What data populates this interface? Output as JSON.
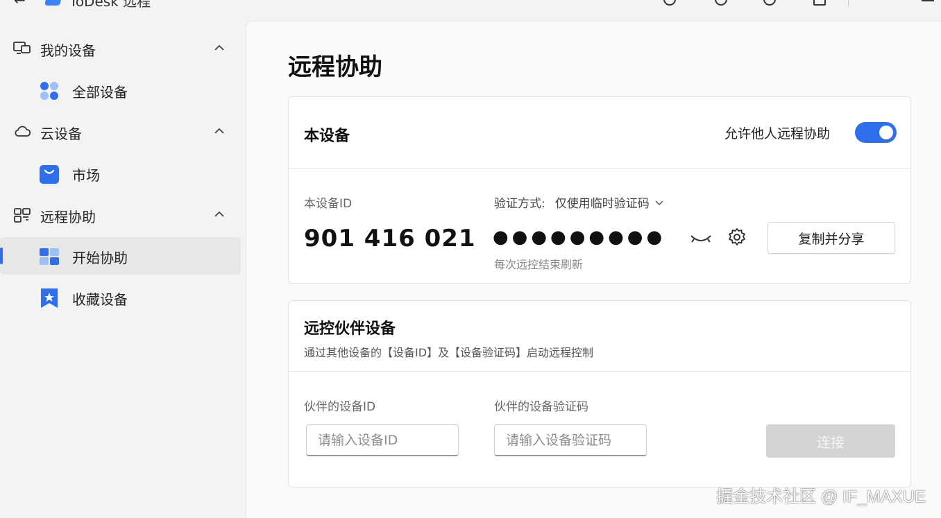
{
  "app": {
    "title": "ToDesk 远程"
  },
  "sidebar": {
    "groups": [
      {
        "label": "我的设备",
        "items": [
          {
            "label": "全部设备"
          }
        ]
      },
      {
        "label": "云设备",
        "items": [
          {
            "label": "市场"
          }
        ]
      },
      {
        "label": "远程协助",
        "items": [
          {
            "label": "开始协助"
          },
          {
            "label": "收藏设备"
          }
        ]
      }
    ]
  },
  "main": {
    "title": "远程协助",
    "this_device": {
      "title": "本设备",
      "allow_label": "允许他人远程协助",
      "allow_enabled": true,
      "id_label": "本设备ID",
      "id_value": "901 416 021",
      "verify_label": "验证方式:",
      "verify_mode": "仅使用临时验证码",
      "password_masked": "●●●●●●●●●",
      "refresh_note": "每次远控结束刷新",
      "copy_button": "复制并分享"
    },
    "partner": {
      "title": "远控伙伴设备",
      "subtitle": "通过其他设备的【设备ID】及【设备验证码】启动远程控制",
      "id_label": "伙伴的设备ID",
      "id_placeholder": "请输入设备ID",
      "code_label": "伙伴的设备验证码",
      "code_placeholder": "请输入设备验证码",
      "connect_button": "连接"
    }
  },
  "watermark": "掘金技术社区 @ IF_MAXUE",
  "colors": {
    "accent": "#2f6fed",
    "disabled": "#d3d3d3"
  }
}
